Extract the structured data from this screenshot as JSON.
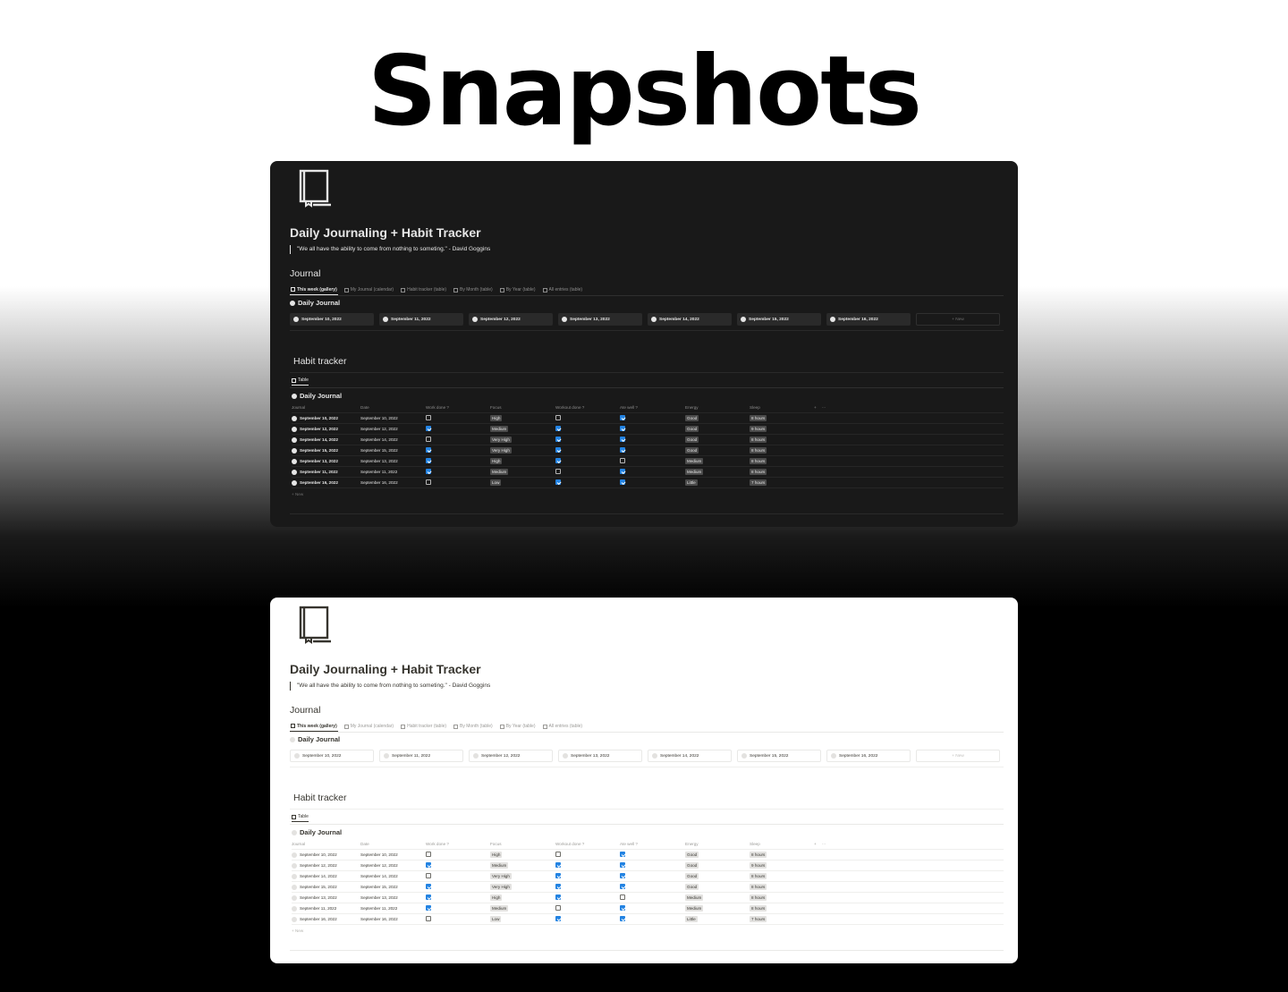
{
  "header": {
    "title": "Snapshots"
  },
  "page": {
    "title": "Daily Journaling + Habit Tracker",
    "quote": "\"We all have the ability to come from nothing to someting.\" - David Goggins",
    "journal_heading": "Journal",
    "tabs": [
      "This week (gallery)",
      "My Journal (calendar)",
      "Habit tracker (table)",
      "By Month (table)",
      "By Year (table)",
      "All entries (table)"
    ],
    "gallery_group": "Daily Journal",
    "gallery_cards": [
      "September 10, 2022",
      "September 11, 2022",
      "September 12, 2022",
      "September 13, 2022",
      "September 14, 2022",
      "September 15, 2022",
      "September 16, 2022"
    ],
    "gallery_new": "+ New",
    "habit_heading": "Habit tracker",
    "table_tab": "Table",
    "table_title": "Daily Journal",
    "columns": [
      "Journal",
      "Date",
      "Work done ?",
      "Focus",
      "Workout done ?",
      "Ate well ?",
      "Energy",
      "Sleep"
    ],
    "rows": [
      {
        "journal": "September 10, 2022",
        "date": "September 10, 2022",
        "work": false,
        "focus": "High",
        "workout": false,
        "ate": true,
        "energy": "Good",
        "sleep": "8 hours"
      },
      {
        "journal": "September 12, 2022",
        "date": "September 12, 2022",
        "work": true,
        "focus": "Medium",
        "workout": true,
        "ate": true,
        "energy": "Good",
        "sleep": "9 hours"
      },
      {
        "journal": "September 14, 2022",
        "date": "September 14, 2022",
        "work": false,
        "focus": "Very High",
        "workout": true,
        "ate": true,
        "energy": "Good",
        "sleep": "8 hours"
      },
      {
        "journal": "September 15, 2022",
        "date": "September 15, 2022",
        "work": true,
        "focus": "Very High",
        "workout": true,
        "ate": true,
        "energy": "Good",
        "sleep": "8 hours"
      },
      {
        "journal": "September 13, 2022",
        "date": "September 13, 2022",
        "work": true,
        "focus": "High",
        "workout": true,
        "ate": false,
        "energy": "Medium",
        "sleep": "8 hours"
      },
      {
        "journal": "September 11, 2022",
        "date": "September 11, 2022",
        "work": true,
        "focus": "Medium",
        "workout": false,
        "ate": true,
        "energy": "Medium",
        "sleep": "8 hours"
      },
      {
        "journal": "September 16, 2022",
        "date": "September 16, 2022",
        "work": false,
        "focus": "Low",
        "workout": true,
        "ate": true,
        "energy": "Little",
        "sleep": "7 hours"
      }
    ],
    "table_new": "+ New"
  },
  "snapshots": [
    {
      "theme": "dark",
      "background": "#191919"
    },
    {
      "theme": "light",
      "background": "#ffffff"
    }
  ],
  "colors": {
    "checkbox_checked": "#2383e2"
  }
}
